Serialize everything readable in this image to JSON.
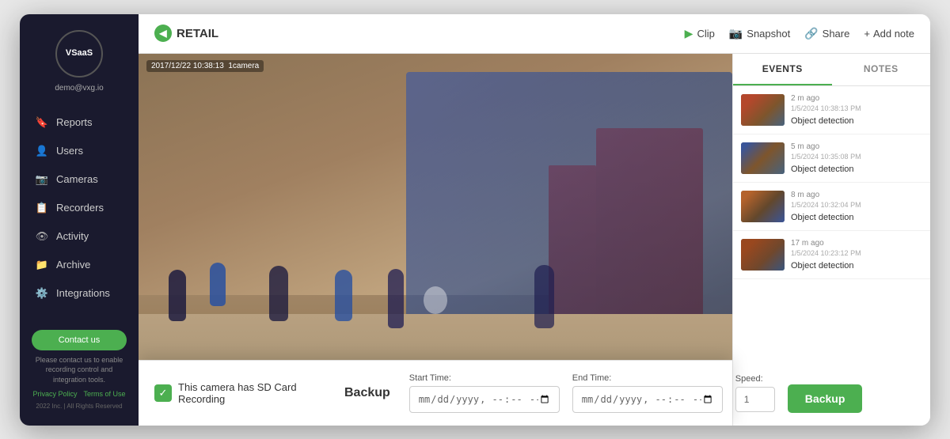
{
  "app": {
    "logo_text": "VSaaS",
    "user": "demo@vxg.io",
    "brand": "RETAIL"
  },
  "sidebar": {
    "items": [
      {
        "id": "reports",
        "label": "Reports",
        "icon": "🔖"
      },
      {
        "id": "users",
        "label": "Users",
        "icon": "👤"
      },
      {
        "id": "cameras",
        "label": "Cameras",
        "icon": "📷"
      },
      {
        "id": "recorders",
        "label": "Recorders",
        "icon": "📋"
      },
      {
        "id": "activity",
        "label": "Activity",
        "icon": "👁"
      },
      {
        "id": "archive",
        "label": "Archive",
        "icon": "📁"
      },
      {
        "id": "integrations",
        "label": "Integrations",
        "icon": "⚙️"
      }
    ],
    "contact_btn": "Contact us",
    "notice": "Please contact us to enable recording control and integration tools.",
    "privacy": "Privacy Policy",
    "terms": "Terms of Use",
    "copyright": "2022 Inc. | All Rights Reserved"
  },
  "topbar": {
    "back_icon": "◀",
    "brand": "RETAIL",
    "actions": [
      {
        "id": "clip",
        "label": "Clip",
        "icon": "▶"
      },
      {
        "id": "snapshot",
        "label": "Snapshot",
        "icon": "📷"
      },
      {
        "id": "share",
        "label": "Share",
        "icon": "🔗"
      },
      {
        "id": "addnote",
        "label": "Add note",
        "icon": "+"
      }
    ]
  },
  "video": {
    "timestamp": "2017/12/22 10:38:13",
    "camera_label": "1camera"
  },
  "backup": {
    "sd_text": "This camera has SD Card Recording",
    "title": "Backup",
    "start_time_label": "Start Time:",
    "start_time_placeholder": "yyyy-mm-dd --:-- --",
    "end_time_label": "End Time:",
    "end_time_placeholder": "yyyy-mm-dd --:-- --",
    "speed_label": "Speed:",
    "speed_value": "1",
    "button_label": "Backup"
  },
  "events": {
    "tab_events": "EVENTS",
    "tab_notes": "NOTES",
    "items": [
      {
        "time_ago": "2 m ago",
        "date": "1/5/2024 10:38:13 PM",
        "type": "Object detection"
      },
      {
        "time_ago": "5 m ago",
        "date": "1/5/2024 10:35:08 PM",
        "type": "Object detection"
      },
      {
        "time_ago": "8 m ago",
        "date": "1/5/2024 10:32:04 PM",
        "type": "Object detection"
      },
      {
        "time_ago": "17 m ago",
        "date": "1/5/2024 10:23:12 PM",
        "type": "Object detection"
      }
    ]
  }
}
